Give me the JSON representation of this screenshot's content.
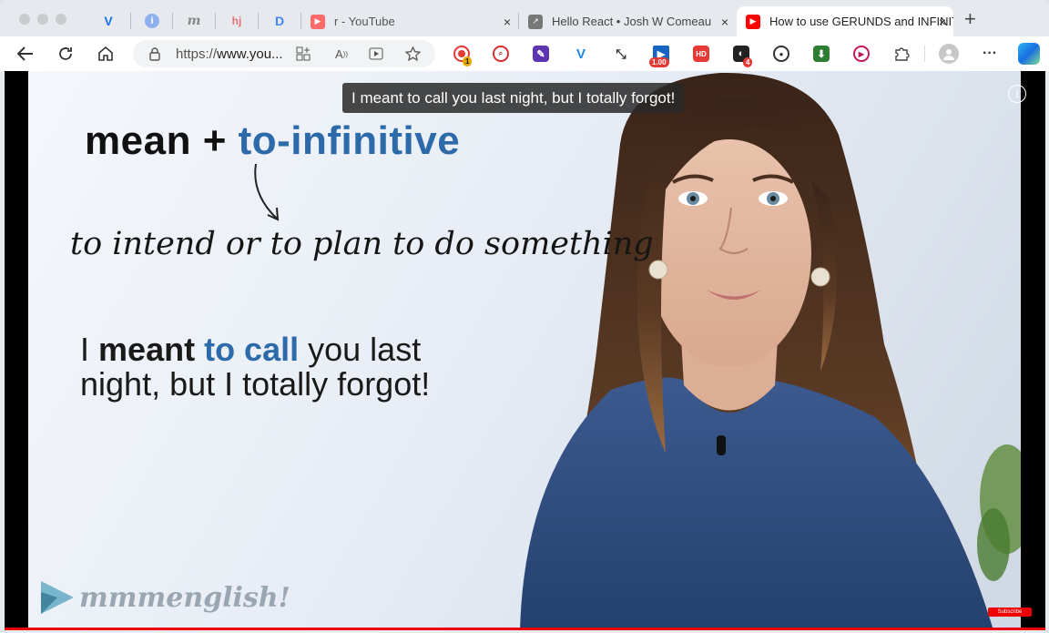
{
  "tabs": [
    {
      "title": "r - YouTube",
      "close": "×"
    },
    {
      "title": "Hello React • Josh W Comeau",
      "close": "×"
    },
    {
      "title": "How to use GERUNDS and INFINITIVES",
      "close": "×",
      "active": true
    }
  ],
  "pinned_tabs": [
    {
      "icon": "vee-icon",
      "glyph": "V",
      "color": "#1a73e8"
    },
    {
      "icon": "info-circle-icon",
      "glyph": "i",
      "color": "#5b8ee6"
    },
    {
      "icon": "m-logo-icon",
      "glyph": "m",
      "color": "#888888"
    },
    {
      "icon": "hj-logo-icon",
      "glyph": "hj",
      "color": "#e57373"
    },
    {
      "icon": "d-logo-icon",
      "glyph": "D",
      "color": "#4285f4"
    }
  ],
  "new_tab_label": "+",
  "address_bar": {
    "url_prefix": "https://",
    "url_domain": "www.you..."
  },
  "extensions": [
    {
      "name": "record-extension-icon",
      "badge": "1",
      "color": "#e53935"
    },
    {
      "name": "search-extension-icon",
      "color": "#d32f2f"
    },
    {
      "name": "pen-extension-icon",
      "color": "#5e35b1"
    },
    {
      "name": "v-extension-icon",
      "color": "#1e88e5"
    },
    {
      "name": "arrows-extension-icon",
      "color": "#333333"
    },
    {
      "name": "speed-extension-icon",
      "badge": "1.00",
      "color": "#1565c0"
    },
    {
      "name": "hd-extension-icon",
      "glyph": "HD",
      "color": "#e53935"
    },
    {
      "name": "dark-extension-icon",
      "badge": "4",
      "color": "#222222"
    },
    {
      "name": "camera-extension-icon",
      "color": "#333333"
    },
    {
      "name": "download-extension-icon",
      "color": "#2e7d32"
    },
    {
      "name": "play-extension-icon",
      "color": "#c2185b"
    },
    {
      "name": "puzzle-extension-icon",
      "color": "#444444"
    }
  ],
  "video": {
    "caption": "I meant to call you last night, but I totally forgot!",
    "info_glyph": "i",
    "headline_black": "mean",
    "headline_plus": "+",
    "headline_blue": "to-infinitive",
    "definition": "to intend or to plan to do something",
    "example_1": "I",
    "example_bold": "meant",
    "example_blue": "to call",
    "example_2": "you last",
    "example_line2": "night, but I totally forgot!",
    "logo_text": "mmmenglish!",
    "subscribe_text": "Subscribe"
  },
  "colors": {
    "accent_blue": "#2d6aa9",
    "youtube_red": "#ff0000"
  }
}
